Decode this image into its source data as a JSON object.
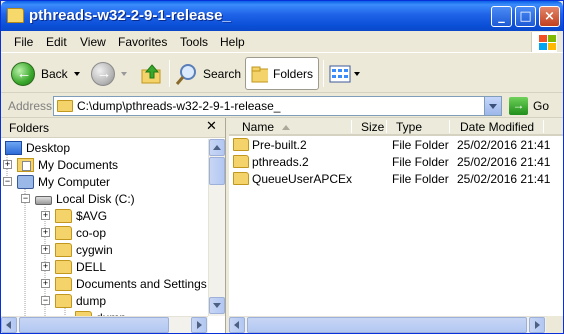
{
  "window": {
    "title": "pthreads-w32-2-9-1-release_"
  },
  "menubar": {
    "items": [
      "File",
      "Edit",
      "View",
      "Favorites",
      "Tools",
      "Help"
    ]
  },
  "toolbar": {
    "back_label": "Back",
    "search_label": "Search",
    "folders_label": "Folders"
  },
  "address": {
    "label": "Address",
    "path": "C:\\dump\\pthreads-w32-2-9-1-release_",
    "go_label": "Go"
  },
  "folders_pane": {
    "title": "Folders",
    "tree": [
      {
        "label": "Desktop",
        "icon": "desktop-icon",
        "expander": ""
      },
      {
        "label": "My Documents",
        "icon": "my-documents-icon",
        "expander": "+"
      },
      {
        "label": "My Computer",
        "icon": "my-computer-icon",
        "expander": "−"
      },
      {
        "label": "Local Disk (C:)",
        "icon": "local-disk-icon",
        "expander": "−"
      },
      {
        "label": "$AVG",
        "icon": "folder-icon",
        "expander": "+"
      },
      {
        "label": "co-op",
        "icon": "folder-icon",
        "expander": "+"
      },
      {
        "label": "cygwin",
        "icon": "folder-icon",
        "expander": "+"
      },
      {
        "label": "DELL",
        "icon": "folder-icon",
        "expander": "+"
      },
      {
        "label": "Documents and Settings",
        "icon": "folder-icon",
        "expander": "+"
      },
      {
        "label": "dump",
        "icon": "folder-icon",
        "expander": "−"
      },
      {
        "label": "dump",
        "icon": "folder-icon",
        "expander": ""
      }
    ]
  },
  "file_list": {
    "columns": [
      "Name",
      "Size",
      "Type",
      "Date Modified"
    ],
    "rows": [
      {
        "name": "Pre-built.2",
        "size": "",
        "type": "File Folder",
        "date": "25/02/2016 21:41"
      },
      {
        "name": "pthreads.2",
        "size": "",
        "type": "File Folder",
        "date": "25/02/2016 21:41"
      },
      {
        "name": "QueueUserAPCEx",
        "size": "",
        "type": "File Folder",
        "date": "25/02/2016 21:41"
      }
    ]
  },
  "colors": {
    "title_blue": "#0b50d8",
    "face": "#ece9d8",
    "folder_yellow": "#f4d36b"
  }
}
